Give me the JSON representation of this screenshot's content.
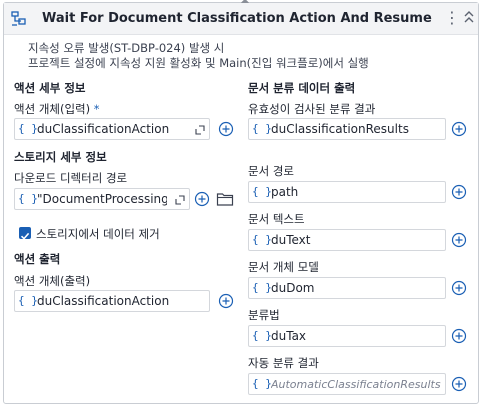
{
  "activity": {
    "title": "Wait For Document Classification Action And Resume",
    "warning_line1": "지속성 오류 발생(ST-DBP-024) 발생 시",
    "warning_line2": "프로젝트 설정에 지속성 지원 활성화 및 Main(진입 워크플로)에서 실행"
  },
  "left": {
    "action_details_header": "액션 세부 정보",
    "action_object_input_label": "액션 개체(입력)",
    "required_mark": "*",
    "action_object_input_value": "duClassificationAction",
    "storage_details_header": "스토리지 세부 정보",
    "download_dir_label": "다운로드 디렉터리 경로",
    "download_dir_value": "\"DocumentProcessing\"",
    "remove_data_label": "스토리지에서 데이터 제거",
    "remove_data_checked": true,
    "action_output_header": "액션 출력",
    "action_object_output_label": "액션 개체(출력)",
    "action_object_output_value": "duClassificationAction"
  },
  "right": {
    "classification_output_header": "문서 분류 데이터 출력",
    "validated_results_label": "유효성이 검사된 분류 결과",
    "validated_results_value": "duClassificationResults",
    "doc_path_label": "문서 경로",
    "doc_path_value": "path",
    "doc_text_label": "문서 텍스트",
    "doc_text_value": "duText",
    "doc_model_label": "문서 개체 모델",
    "doc_model_value": "duDom",
    "taxonomy_label": "분류법",
    "taxonomy_value": "duTax",
    "auto_results_label": "자동 분류 결과",
    "auto_results_placeholder": "AutomaticClassificationResults"
  },
  "glyphs": {
    "brace": "{ }",
    "kebab": "⋮"
  },
  "colors": {
    "accent": "#1a5fb4",
    "header_bg": "#f3f4f6",
    "border": "#c9cdd3"
  },
  "icons": [
    "activity-icon",
    "kebab-menu-icon",
    "collapse-icon",
    "expression-brace-icon",
    "expand-editor-icon",
    "plus-circle-icon",
    "folder-icon",
    "checkmark-icon"
  ]
}
